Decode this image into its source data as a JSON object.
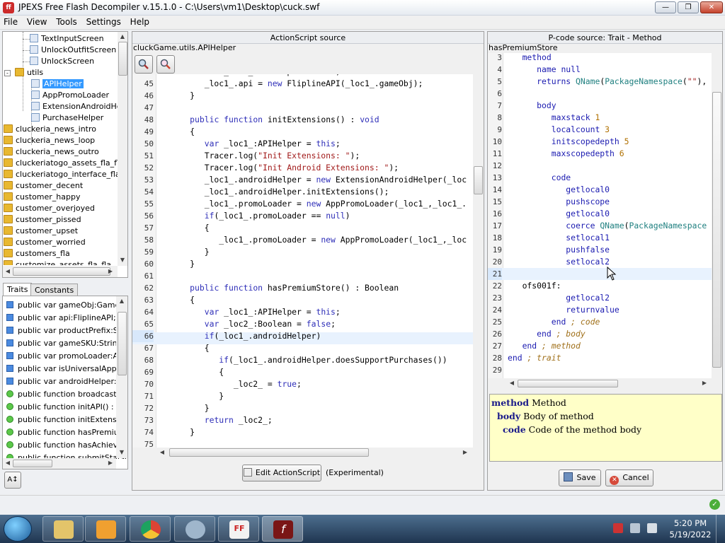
{
  "window": {
    "title": "JPEXS Free Flash Decompiler v.15.1.0 - C:\\Users\\vm1\\Desktop\\cuck.swf"
  },
  "menu": [
    "File",
    "View",
    "Tools",
    "Settings",
    "Help"
  ],
  "tree": {
    "items": [
      "TextInputScreen",
      "UnlockOutfitScreen",
      "UnlockScreen",
      "utils",
      "APIHelper",
      "AppPromoLoader",
      "ExtensionAndroidHelp",
      "PurchaseHelper",
      "cluckeria_news_intro",
      "cluckeria_news_loop",
      "cluckeria_news_outro",
      "cluckeriatogo_assets_fla_fla",
      "cluckeriatogo_interface_fla_f",
      "customer_decent",
      "customer_happy",
      "customer_overjoyed",
      "customer_pissed",
      "customer_upset",
      "customer_worried",
      "customers_fla",
      "customize_assets_fla_fla"
    ],
    "selected": "APIHelper"
  },
  "tabs": {
    "traits": "Traits",
    "constants": "Constants"
  },
  "traits": [
    "public var gameObj:GameMc",
    "public var api:FliplineAPI;",
    "public var productPrefix:Stri",
    "public var gameSKU:String =",
    "public var promoLoader:App",
    "public var isUniversalApp:Bo",
    "public var androidHelper:Ext",
    "public function broadcastEv",
    "public function initAPI() : vo",
    "public function initExtension",
    "public function hasPremiumS",
    "public function hasAchievem",
    "public function submitStatsC"
  ],
  "as": {
    "header": "ActionScript source",
    "breadcrumb": "cluckGame.utils.APIHelper",
    "edit_button": "Edit ActionScript",
    "experimental": "(Experimental)",
    "current_line": "66"
  },
  "pcode": {
    "header": "P-code source: Trait - Method",
    "breadcrumb": "hasPremiumStore",
    "doc_method_kw": "method",
    "doc_method": "Method",
    "doc_body_kw": "body",
    "doc_body": "Body of method",
    "doc_code_kw": "code",
    "doc_code": "Code of the method body",
    "save": "Save",
    "cancel": "Cancel",
    "current_line": "21"
  },
  "clock": {
    "time": "5:20 PM",
    "date": "5/19/2022"
  },
  "colors": {
    "selection": "#3399ff",
    "doc_bg": "#ffffc8",
    "line_highlight": "#e8f2fe",
    "keyword": "#2e2eb8"
  }
}
